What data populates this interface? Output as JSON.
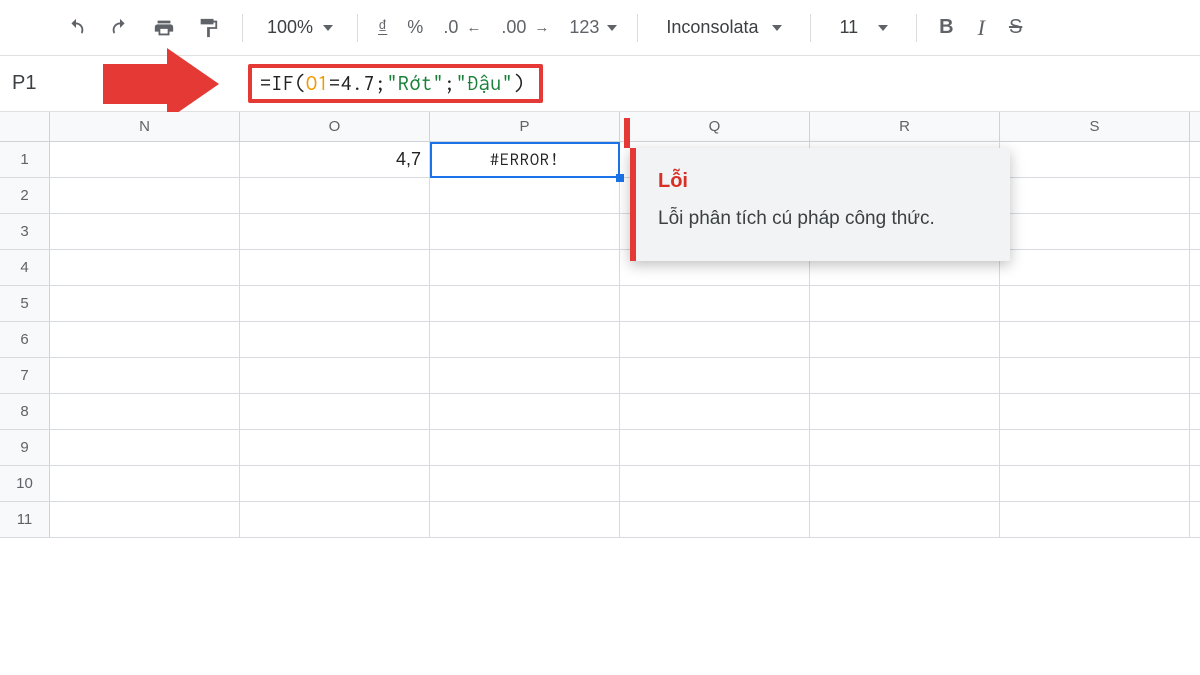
{
  "toolbar": {
    "zoom": "100%",
    "currency_symbol": "₫",
    "percent": "%",
    "dec_less": ".0",
    "dec_more": ".00",
    "num_format": "123",
    "font": "Inconsolata",
    "font_size": "11",
    "bold": "B",
    "italic": "I",
    "strike": "S"
  },
  "fx": {
    "cell_ref": "P1",
    "prefix": "=IF(",
    "ref": "O1",
    "mid1": "=4.7;",
    "str1": "\"Rớt\"",
    "mid2": "; ",
    "str2": "\"Đậu\"",
    "suffix": ")"
  },
  "columns": [
    "N",
    "O",
    "P",
    "Q",
    "R",
    "S"
  ],
  "rows": [
    "1",
    "2",
    "3",
    "4",
    "5",
    "6",
    "7",
    "8",
    "9",
    "10",
    "11"
  ],
  "cells": {
    "O1": "4,7",
    "P1": "#ERROR!"
  },
  "tooltip": {
    "title": "Lỗi",
    "body": "Lỗi phân tích cú pháp công thức."
  }
}
